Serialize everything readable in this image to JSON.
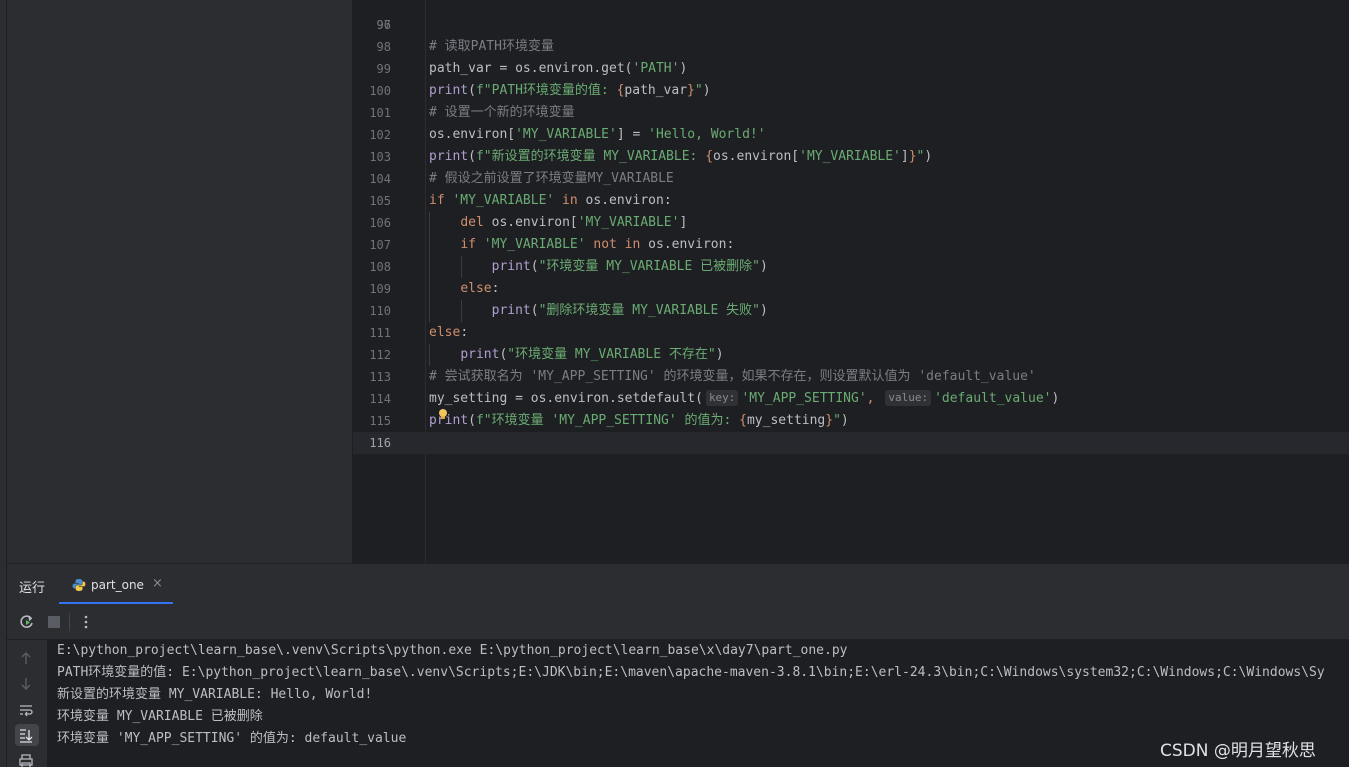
{
  "editor": {
    "top_partial_line_number": "96",
    "lines": [
      {
        "num": "97",
        "tokens": []
      },
      {
        "num": "98",
        "tokens": [
          {
            "t": "# 读取PATH环境变量",
            "c": "c"
          }
        ]
      },
      {
        "num": "99",
        "tokens": [
          {
            "t": "path_var = os.environ.get(",
            "c": ""
          },
          {
            "t": "'PATH'",
            "c": "s"
          },
          {
            "t": ")",
            "c": ""
          }
        ]
      },
      {
        "num": "100",
        "tokens": [
          {
            "t": "print",
            "c": "fn"
          },
          {
            "t": "(",
            "c": ""
          },
          {
            "t": "f\"PATH环境变量的值: ",
            "c": "s"
          },
          {
            "t": "{",
            "c": "br"
          },
          {
            "t": "path_var",
            "c": ""
          },
          {
            "t": "}",
            "c": "br"
          },
          {
            "t": "\"",
            "c": "s"
          },
          {
            "t": ")",
            "c": ""
          }
        ]
      },
      {
        "num": "101",
        "tokens": [
          {
            "t": "# 设置一个新的环境变量",
            "c": "c"
          }
        ]
      },
      {
        "num": "102",
        "tokens": [
          {
            "t": "os.environ[",
            "c": ""
          },
          {
            "t": "'MY_VARIABLE'",
            "c": "s"
          },
          {
            "t": "] = ",
            "c": ""
          },
          {
            "t": "'Hello, World!'",
            "c": "s"
          }
        ]
      },
      {
        "num": "103",
        "tokens": [
          {
            "t": "print",
            "c": "fn"
          },
          {
            "t": "(",
            "c": ""
          },
          {
            "t": "f\"新设置的环境变量 MY_VARIABLE: ",
            "c": "s"
          },
          {
            "t": "{",
            "c": "br"
          },
          {
            "t": "os.environ[",
            "c": ""
          },
          {
            "t": "'MY_VARIABLE'",
            "c": "s"
          },
          {
            "t": "]",
            "c": ""
          },
          {
            "t": "}",
            "c": "br"
          },
          {
            "t": "\"",
            "c": "s"
          },
          {
            "t": ")",
            "c": ""
          }
        ]
      },
      {
        "num": "104",
        "tokens": [
          {
            "t": "# 假设之前设置了环境变量MY_VARIABLE",
            "c": "c"
          }
        ]
      },
      {
        "num": "105",
        "tokens": [
          {
            "t": "if ",
            "c": "k"
          },
          {
            "t": "'MY_VARIABLE'",
            "c": "s"
          },
          {
            "t": " in ",
            "c": "k"
          },
          {
            "t": "os.environ:",
            "c": ""
          }
        ]
      },
      {
        "num": "106",
        "tokens": [
          {
            "t": "    ",
            "c": ""
          },
          {
            "t": "del ",
            "c": "k"
          },
          {
            "t": "os.environ[",
            "c": ""
          },
          {
            "t": "'MY_VARIABLE'",
            "c": "s"
          },
          {
            "t": "]",
            "c": ""
          }
        ]
      },
      {
        "num": "107",
        "tokens": [
          {
            "t": "    ",
            "c": ""
          },
          {
            "t": "if ",
            "c": "k"
          },
          {
            "t": "'MY_VARIABLE'",
            "c": "s"
          },
          {
            "t": " not in ",
            "c": "k"
          },
          {
            "t": "os.environ:",
            "c": ""
          }
        ]
      },
      {
        "num": "108",
        "tokens": [
          {
            "t": "        ",
            "c": ""
          },
          {
            "t": "print",
            "c": "fn"
          },
          {
            "t": "(",
            "c": ""
          },
          {
            "t": "\"环境变量 MY_VARIABLE 已被删除\"",
            "c": "s"
          },
          {
            "t": ")",
            "c": ""
          }
        ]
      },
      {
        "num": "109",
        "tokens": [
          {
            "t": "    ",
            "c": ""
          },
          {
            "t": "else",
            "c": "k"
          },
          {
            "t": ":",
            "c": ""
          }
        ]
      },
      {
        "num": "110",
        "tokens": [
          {
            "t": "        ",
            "c": ""
          },
          {
            "t": "print",
            "c": "fn"
          },
          {
            "t": "(",
            "c": ""
          },
          {
            "t": "\"删除环境变量 MY_VARIABLE 失败\"",
            "c": "s"
          },
          {
            "t": ")",
            "c": ""
          }
        ]
      },
      {
        "num": "111",
        "tokens": [
          {
            "t": "else",
            "c": "k"
          },
          {
            "t": ":",
            "c": ""
          }
        ]
      },
      {
        "num": "112",
        "tokens": [
          {
            "t": "    ",
            "c": ""
          },
          {
            "t": "print",
            "c": "fn"
          },
          {
            "t": "(",
            "c": ""
          },
          {
            "t": "\"环境变量 MY_VARIABLE 不存在\"",
            "c": "s"
          },
          {
            "t": ")",
            "c": ""
          }
        ]
      },
      {
        "num": "113",
        "tokens": [
          {
            "t": "# 尝试获取名为 'MY_APP_SETTING' 的环境变量，如果不存在，则设置默认值为 'default_value'",
            "c": "c"
          }
        ]
      },
      {
        "num": "114",
        "tokens": [
          {
            "t": "my_setting = os.environ.setdefault(",
            "c": ""
          },
          {
            "t": "key:",
            "c": "hint"
          },
          {
            "t": "'MY_APP_SETTING'",
            "c": "s"
          },
          {
            "t": ", ",
            "c": "k"
          },
          {
            "t": "value:",
            "c": "hint"
          },
          {
            "t": "'default_value'",
            "c": "s"
          },
          {
            "t": ")",
            "c": ""
          }
        ]
      },
      {
        "num": "115",
        "tokens": [
          {
            "t": "print",
            "c": "fn"
          },
          {
            "t": "(",
            "c": ""
          },
          {
            "t": "f\"环境变量 'MY_APP_SETTING' 的值为: ",
            "c": "s"
          },
          {
            "t": "{",
            "c": "br"
          },
          {
            "t": "my_setting",
            "c": ""
          },
          {
            "t": "}",
            "c": "br"
          },
          {
            "t": "\"",
            "c": "s"
          },
          {
            "t": ")",
            "c": ""
          }
        ]
      },
      {
        "num": "116",
        "tokens": [],
        "current": true
      }
    ]
  },
  "run_panel": {
    "title": "运行",
    "tab_label": "part_one",
    "tab_close": "×",
    "console_lines": [
      "E:\\python_project\\learn_base\\.venv\\Scripts\\python.exe E:\\python_project\\learn_base\\x\\day7\\part_one.py",
      "PATH环境变量的值: E:\\python_project\\learn_base\\.venv\\Scripts;E:\\JDK\\bin;E:\\maven\\apache-maven-3.8.1\\bin;E:\\erl-24.3\\bin;C:\\Windows\\system32;C:\\Windows;C:\\Windows\\Sy",
      "新设置的环境变量 MY_VARIABLE: Hello, World!",
      "环境变量 MY_VARIABLE 已被删除",
      "环境变量 'MY_APP_SETTING' 的值为: default_value"
    ]
  },
  "watermark": "CSDN @明月望秋思",
  "colors": {
    "editor_bg": "#1e1f22",
    "panel_bg": "#2b2d30",
    "comment": "#7a7e85",
    "keyword": "#cf8e6d",
    "string": "#6aab73",
    "builtin": "#b09fd0",
    "accent": "#3574f0"
  }
}
